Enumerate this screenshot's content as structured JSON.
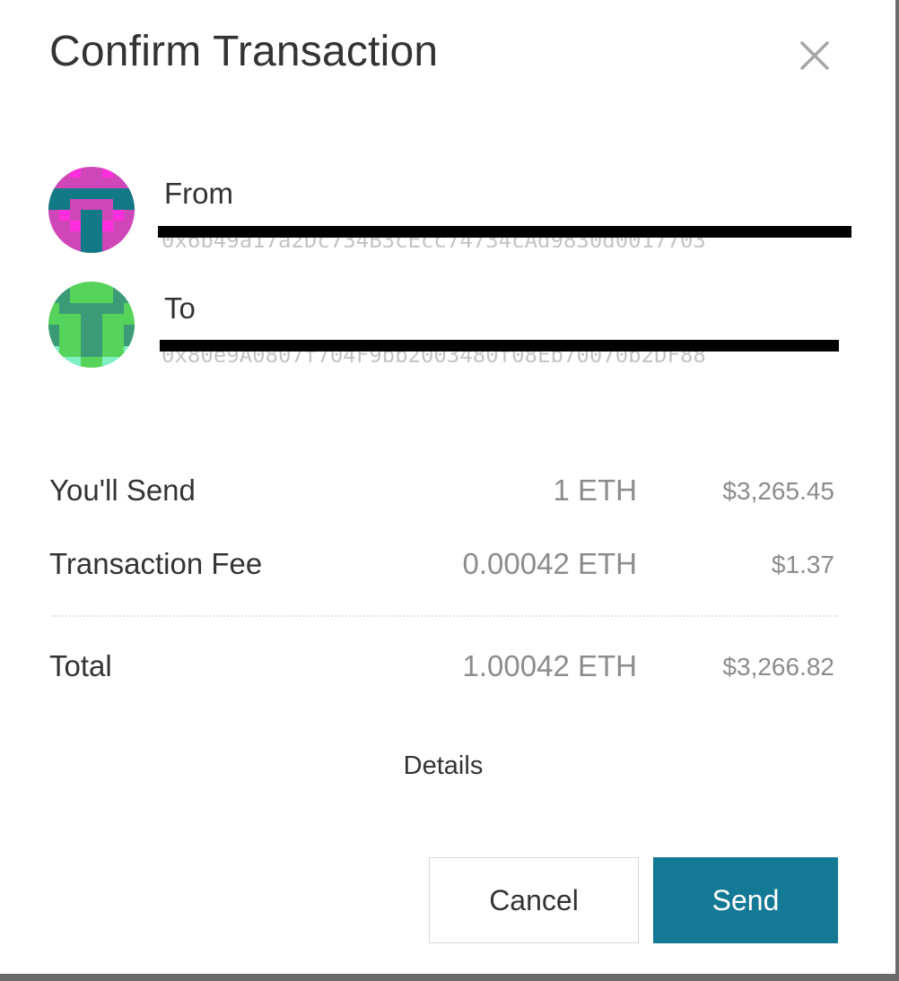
{
  "dialog": {
    "title": "Confirm Transaction",
    "close_icon": "close-icon"
  },
  "from": {
    "label": "From",
    "address": "0x6b49a17a2Dc734B3cEcc74734cAd9830d0017703",
    "avatar_icon": "identicon-magenta",
    "avatar_colors": [
      "#cf46b8",
      "#127a87",
      "#ff2fde"
    ]
  },
  "to": {
    "label": "To",
    "address": "0x80e9A0807f704F9bb2003480f08Eb70070b2DF88",
    "avatar_icon": "identicon-green",
    "avatar_colors": [
      "#56d35a",
      "#3a9b76",
      "#7ef0c2"
    ]
  },
  "summary": {
    "send": {
      "label": "You'll Send",
      "eth": "1 ETH",
      "usd": "$3,265.45"
    },
    "fee": {
      "label": "Transaction Fee",
      "eth": "0.00042 ETH",
      "usd": "$1.37"
    },
    "total": {
      "label": "Total",
      "eth": "1.00042 ETH",
      "usd": "$3,266.82"
    }
  },
  "details_label": "Details",
  "actions": {
    "cancel_label": "Cancel",
    "send_label": "Send"
  },
  "colors": {
    "primary": "#147994",
    "text": "#333333",
    "muted": "#8c8c8c"
  }
}
